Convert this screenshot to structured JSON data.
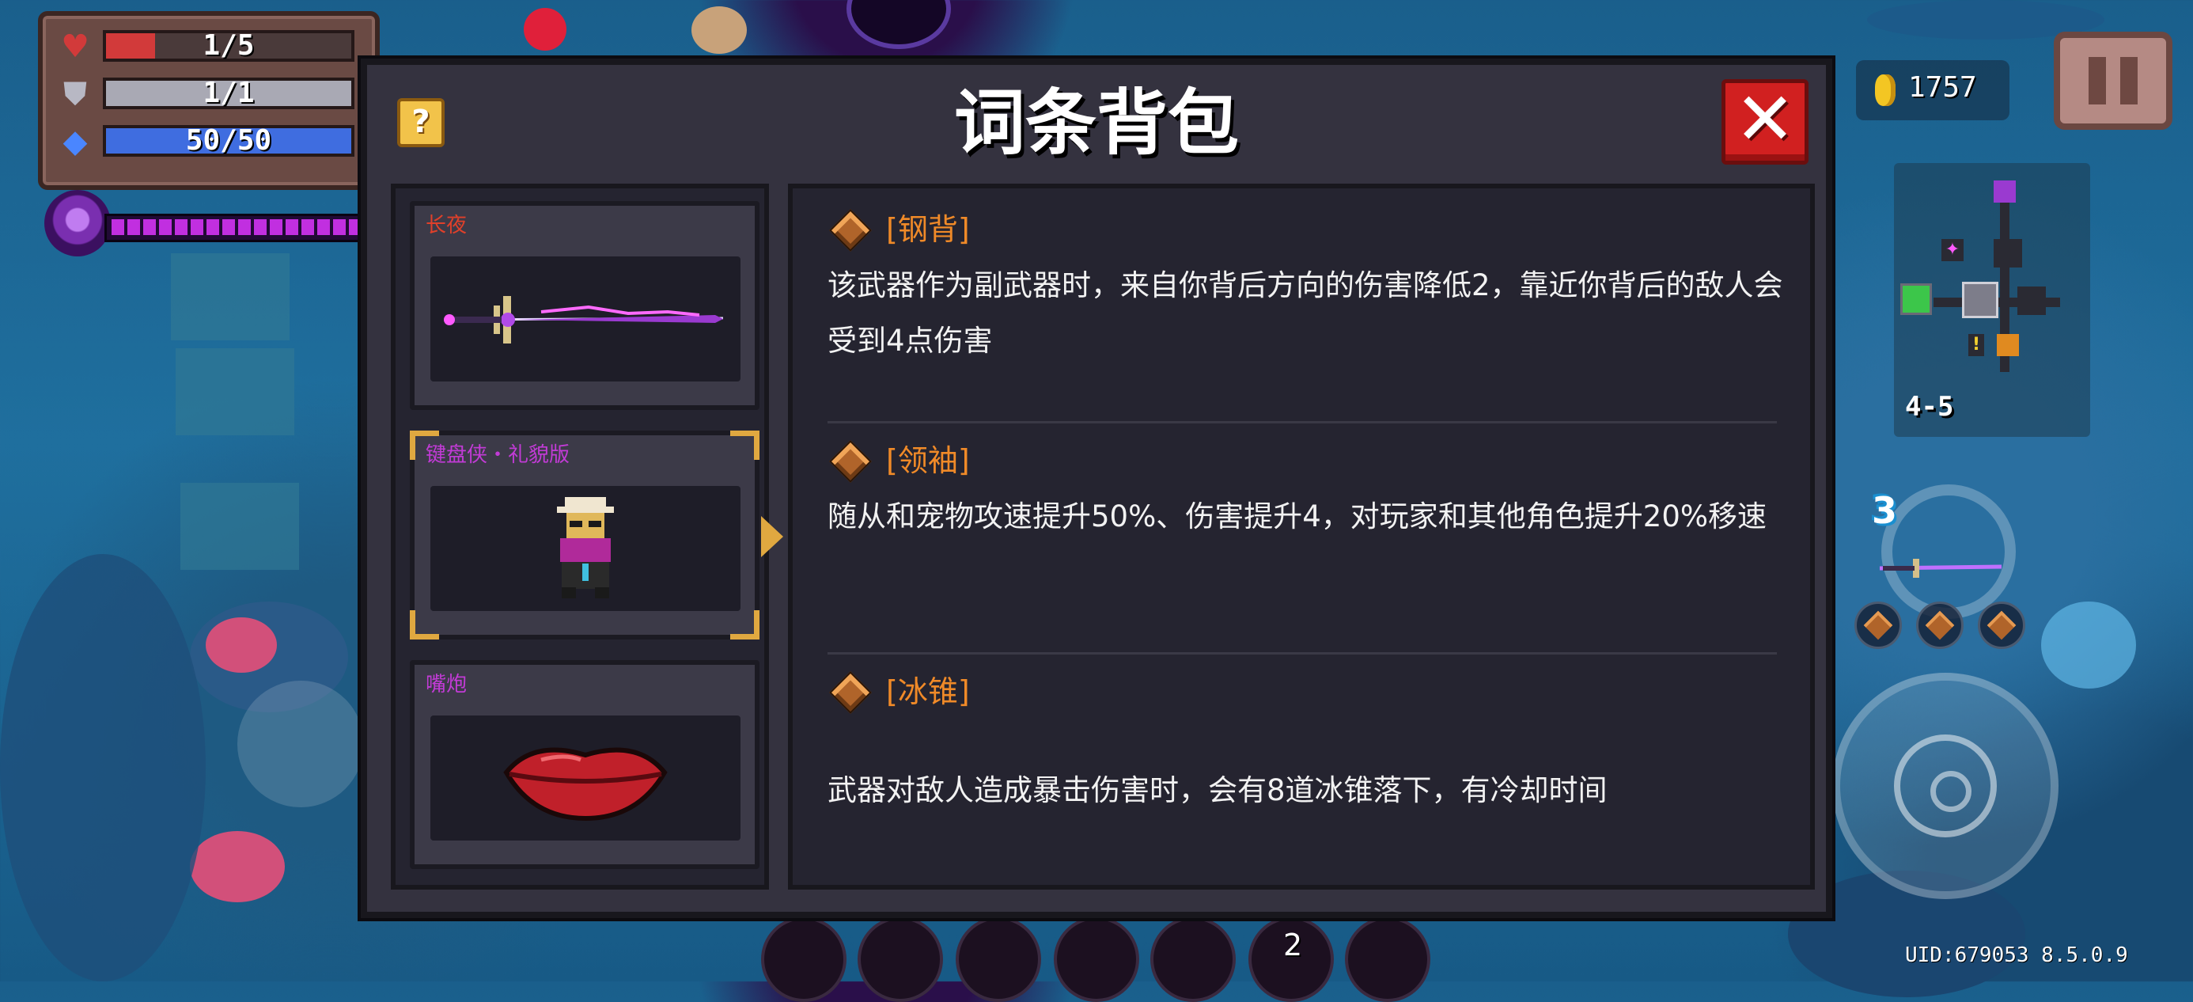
{
  "hud": {
    "health": "1/5",
    "health_fill": 0.2,
    "armor": "1/1",
    "armor_fill": 1.0,
    "energy": "50/50",
    "energy_fill": 1.0,
    "icons": [
      "heart-icon",
      "shield-icon",
      "energy-diamond-icon"
    ]
  },
  "coins": "1757",
  "level": "4-5",
  "weapon_count": "3",
  "uid": "UID:679053 8.5.0.9",
  "page_number": "2",
  "modal": {
    "title": "词条背包",
    "help_label": "?",
    "close_label": "✕"
  },
  "items": [
    {
      "name": "长夜",
      "name_color": "#e0402a",
      "icon": "purple-sword-icon",
      "selected": false
    },
    {
      "name": "键盘侠・礼貌版",
      "name_color": "#c23bd6",
      "icon": "keyboard-warrior-pet-icon",
      "selected": true
    },
    {
      "name": "嘴炮",
      "name_color": "#c23bd6",
      "icon": "red-lips-icon",
      "selected": false
    }
  ],
  "entries": [
    {
      "title": "[钢背]",
      "desc": "该武器作为副武器时，来自你背后方向的伤害降低2，靠近你背后的敌人会受到4点伤害"
    },
    {
      "title": "[领袖]",
      "desc": "随从和宠物攻速提升50%、伤害提升4，对玩家和其他角色提升20%移速"
    },
    {
      "title": "[冰锥]",
      "desc": "武器对敌人造成暴击伤害时，会有8道冰锥落下，有冷却时间"
    }
  ],
  "colors": {
    "accent_orange": "#f08a28",
    "close_red": "#d12020",
    "help_yellow": "#f2c34a",
    "health_red": "#d23a3a",
    "armor_gray": "#a9a9b4",
    "energy_blue": "#3f6de0"
  }
}
